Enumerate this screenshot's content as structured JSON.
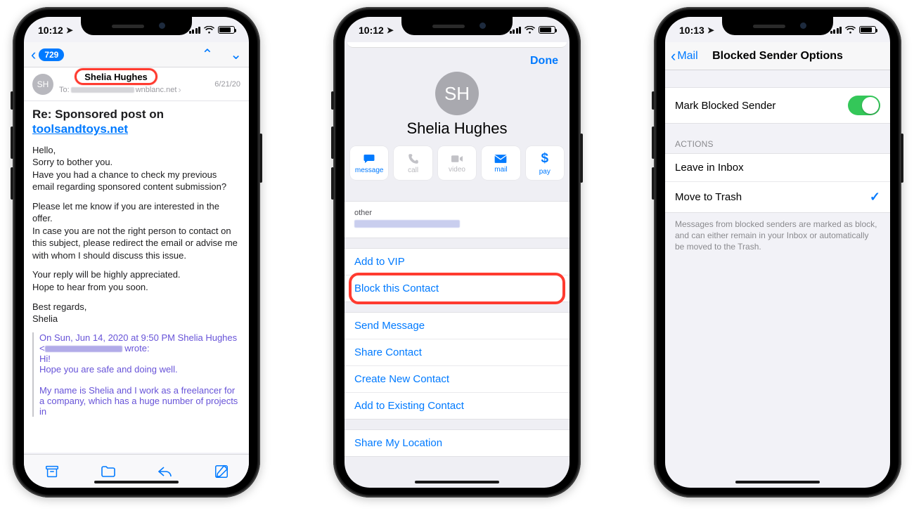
{
  "phone1": {
    "time": "10:12",
    "inbox_badge": "729",
    "avatar_initials": "SH",
    "sender_name": "Shelia Hughes",
    "to_prefix": "To:",
    "to_suffix": "wnblanc.net",
    "date": "6/21/20",
    "subject_prefix": "Re: Sponsored post on ",
    "subject_link": "toolsandtoys.net",
    "body_l1": "Hello,",
    "body_l2": "Sorry to bother you.",
    "body_l3": "Have you had a chance to check my previous email regarding sponsored content submission?",
    "body_p2": "Please let me know if you are interested in the offer.",
    "body_p2b": "In case you are not the right person to contact on this subject, please redirect the email or advise me with whom I should discuss this issue.",
    "body_p3a": "Your reply will be highly appreciated.",
    "body_p3b": "Hope to hear from you soon.",
    "body_signa": "Best regards,",
    "body_signb": "Shelia",
    "quote_l1a": "On Sun, Jun 14, 2020 at 9:50 PM Shelia Hughes",
    "quote_l1b_prefix": "<",
    "quote_l1b_suffix": " wrote:",
    "quote_l2": "Hi!",
    "quote_l3": "Hope you are safe and doing well.",
    "quote_l4": "My name is Shelia and I work as a freelancer for a company, which has a huge number of projects in"
  },
  "phone2": {
    "time": "10:12",
    "done": "Done",
    "avatar_initials": "SH",
    "name": "Shelia Hughes",
    "act_message": "message",
    "act_call": "call",
    "act_video": "video",
    "act_mail": "mail",
    "act_pay": "pay",
    "field_key": "other",
    "add_vip": "Add to VIP",
    "block": "Block this Contact",
    "send_msg": "Send Message",
    "share_contact": "Share Contact",
    "create_contact": "Create New Contact",
    "add_existing": "Add to Existing Contact",
    "share_location": "Share My Location"
  },
  "phone3": {
    "time": "10:13",
    "back_label": "Mail",
    "title": "Blocked Sender Options",
    "row_mark": "Mark Blocked Sender",
    "section_actions": "ACTIONS",
    "row_leave": "Leave in Inbox",
    "row_trash": "Move to Trash",
    "footer": "Messages from blocked senders are marked as block, and can either remain in your Inbox or automatically be moved to the Trash."
  }
}
